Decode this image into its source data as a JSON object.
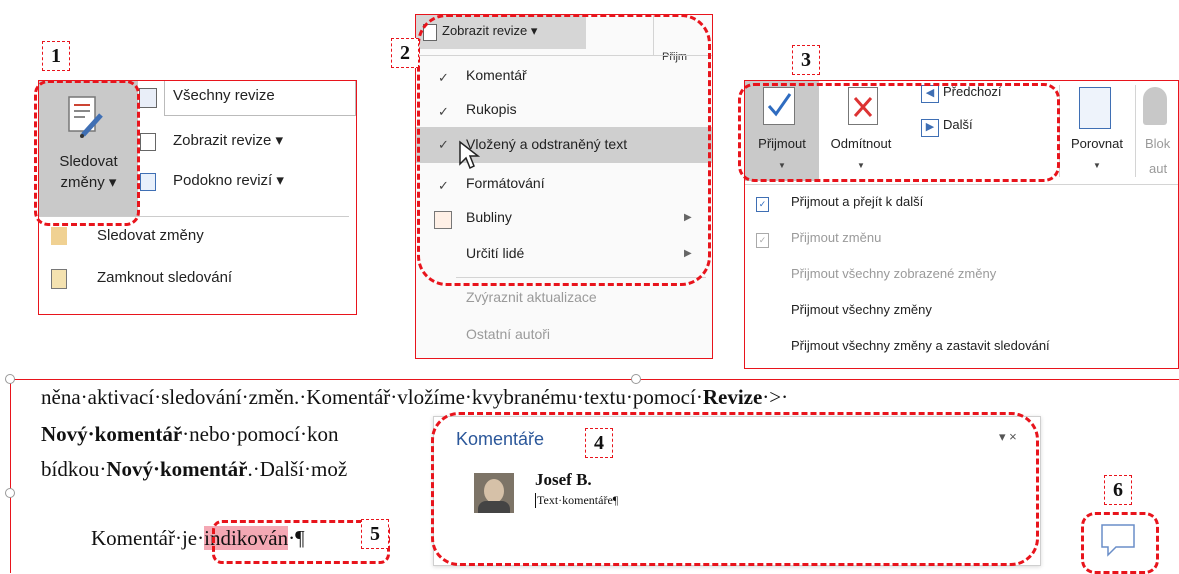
{
  "labels": {
    "n1": "1",
    "n2": "2",
    "n3": "3",
    "n4": "4",
    "n5": "5",
    "n6": "6"
  },
  "panel1": {
    "track_button": {
      "line1": "Sledovat",
      "line2": "změny ▾"
    },
    "items": [
      "Všechny revize",
      "Zobrazit revize ▾",
      "Podokno revizí  ▾"
    ],
    "menu": [
      "Sledovat změny",
      "Zamknout sledování"
    ]
  },
  "panel2": {
    "header": "Zobrazit revize ▾",
    "side": "Přijm",
    "items": [
      {
        "label": "Komentář",
        "checked": true
      },
      {
        "label": "Rukopis",
        "checked": true
      },
      {
        "label": "Vložený a odstraněný text",
        "checked": true
      },
      {
        "label": "Formátování",
        "checked": true
      },
      {
        "label": "Bubliny",
        "checked": false
      },
      {
        "label": "Určití lidé",
        "checked": false
      }
    ],
    "disabled": [
      "Zvýraznit aktualizace",
      "Ostatní autoři"
    ]
  },
  "panel3": {
    "accept": "Přijmout",
    "reject": "Odmítnout",
    "prev": "Předchozí",
    "next": "Další",
    "compare": "Porovnat",
    "block1": "Blok",
    "block2": "aut",
    "menu": [
      {
        "label": "Přijmout a přejít k další",
        "enabled": true
      },
      {
        "label": "Přijmout změnu",
        "enabled": false
      },
      {
        "label": "Přijmout všechny zobrazené změny",
        "enabled": false
      },
      {
        "label": "Přijmout všechny změny",
        "enabled": true
      },
      {
        "label": "Přijmout všechny změny a zastavit sledování",
        "enabled": true
      }
    ]
  },
  "doc": {
    "line1_a": "něna·aktivací·sledování·změn.·Komentář·vložíme·k",
    "line1_b": "vybranému·textu·pomocí·",
    "line1_bold": "Revize",
    "line1_c": "·>·",
    "line2_bold1": "Nový·komentář",
    "line2_a": "·nebo·pomocí·kon",
    "line3_a": "bídkou·",
    "line3_bold": "Nový·komentář",
    "line3_b": ".·Další·mož",
    "line4_a": "Komentář·je·",
    "line4_hl": "indikován",
    "line4_b": "·¶"
  },
  "comments": {
    "title": "Komentáře",
    "controls": "▾ ×",
    "author": "Josef B.",
    "text": "Text·komentáře¶"
  },
  "colors": {
    "accent": "#e8141c",
    "highlight": "#f4a8b4",
    "title_blue": "#2b579a"
  }
}
